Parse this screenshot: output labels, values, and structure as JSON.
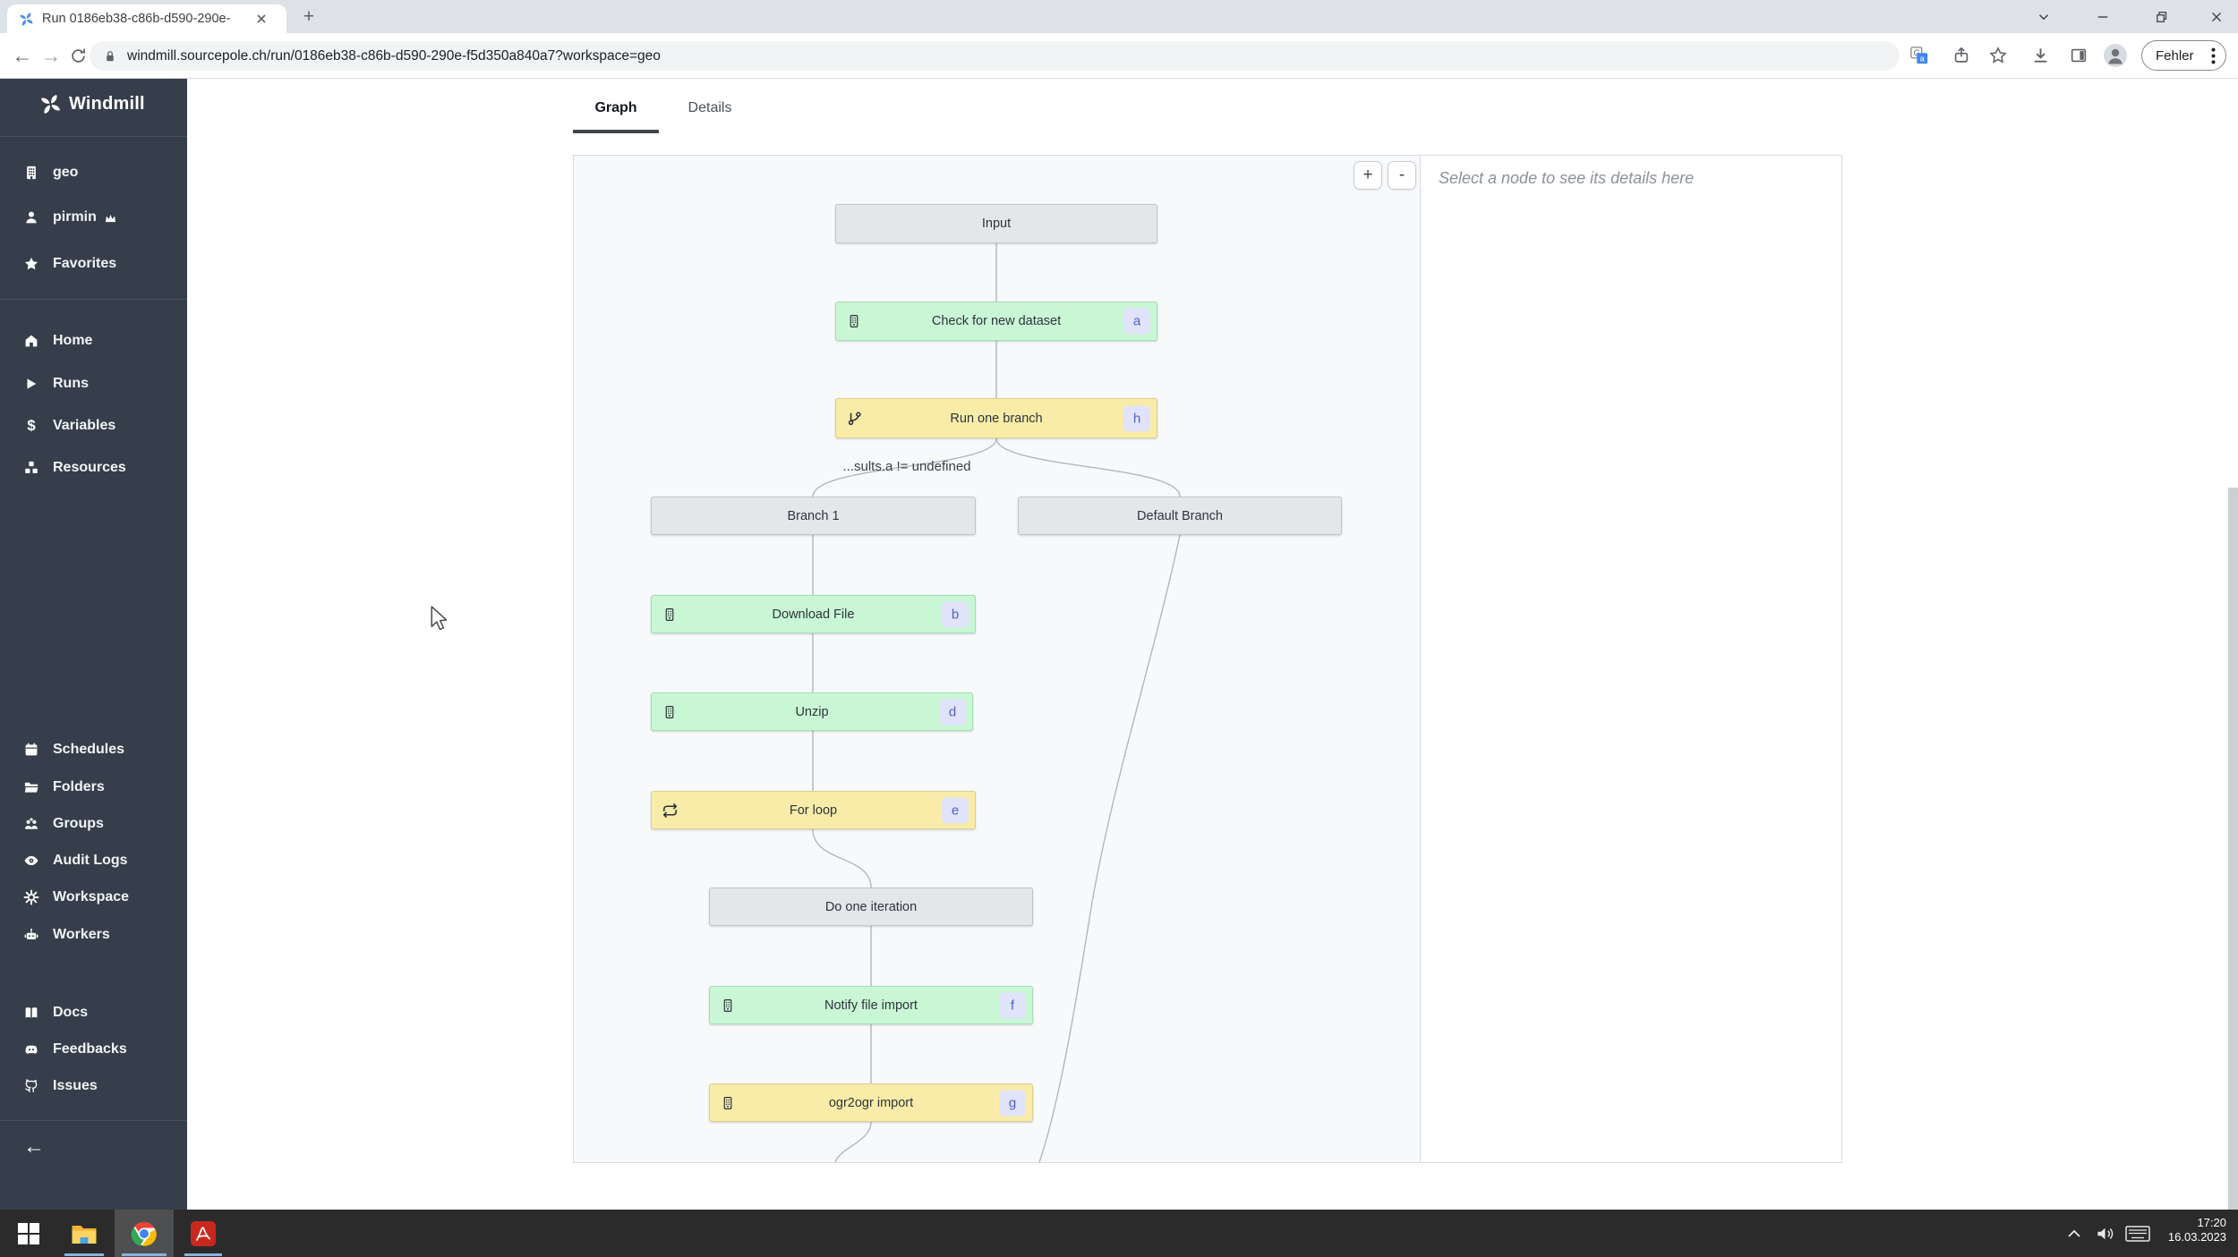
{
  "browser": {
    "tab_title": "Run 0186eb38-c86b-d590-290e-",
    "new_tab_label": "+",
    "url": "windmill.sourcepole.ch/run/0186eb38-c86b-d590-290e-f5d350a840a7?workspace=geo",
    "menu_badge_label": "Fehler"
  },
  "sidebar": {
    "logo_text": "Windmill",
    "workspace_label": "geo",
    "user_label": "pirmin",
    "favorites_label": "Favorites",
    "nav": [
      {
        "label": "Home"
      },
      {
        "label": "Runs"
      },
      {
        "label": "Variables"
      },
      {
        "label": "Resources"
      }
    ],
    "admin_nav": [
      {
        "label": "Schedules"
      },
      {
        "label": "Folders"
      },
      {
        "label": "Groups"
      },
      {
        "label": "Audit Logs"
      },
      {
        "label": "Workspace"
      },
      {
        "label": "Workers"
      }
    ],
    "meta_nav": [
      {
        "label": "Docs"
      },
      {
        "label": "Feedbacks"
      },
      {
        "label": "Issues"
      }
    ]
  },
  "main": {
    "tabs": [
      {
        "label": "Graph",
        "active": true
      },
      {
        "label": "Details",
        "active": false
      }
    ],
    "graph": {
      "zoom_in_label": "+",
      "zoom_out_label": "-",
      "edge_label": "...sults.a != undefined",
      "nodes": [
        {
          "label": "Input",
          "kind": "virtual"
        },
        {
          "label": "Check for new dataset",
          "badge": "a",
          "kind": "success"
        },
        {
          "label": "Run one branch",
          "badge": "h",
          "kind": "running"
        },
        {
          "label": "Branch 1",
          "kind": "virtual"
        },
        {
          "label": "Default Branch",
          "kind": "virtual"
        },
        {
          "label": "Download File",
          "badge": "b",
          "kind": "success"
        },
        {
          "label": "Unzip",
          "badge": "d",
          "kind": "success"
        },
        {
          "label": "For loop",
          "badge": "e",
          "kind": "running"
        },
        {
          "label": "Do one iteration",
          "kind": "virtual"
        },
        {
          "label": "Notify file import",
          "badge": "f",
          "kind": "success"
        },
        {
          "label": "ogr2ogr import",
          "badge": "g",
          "kind": "running"
        }
      ]
    },
    "details_placeholder": "Select a node to see its details here"
  },
  "taskbar": {
    "time": "17:20",
    "date": "16.03.2023"
  },
  "colors": {
    "sidebar_bg": "#353e4a",
    "node_success_bg": "#c9f7d5",
    "node_running_bg": "#f8eca8",
    "node_virtual_bg": "#e4e6e9",
    "badge_bg": "#e0e3fa",
    "badge_text": "#5160c4",
    "tab_underline": "#3f444b",
    "taskbar_bg": "#2b2b2c",
    "taskbar_indicator": "#85b3dd"
  }
}
